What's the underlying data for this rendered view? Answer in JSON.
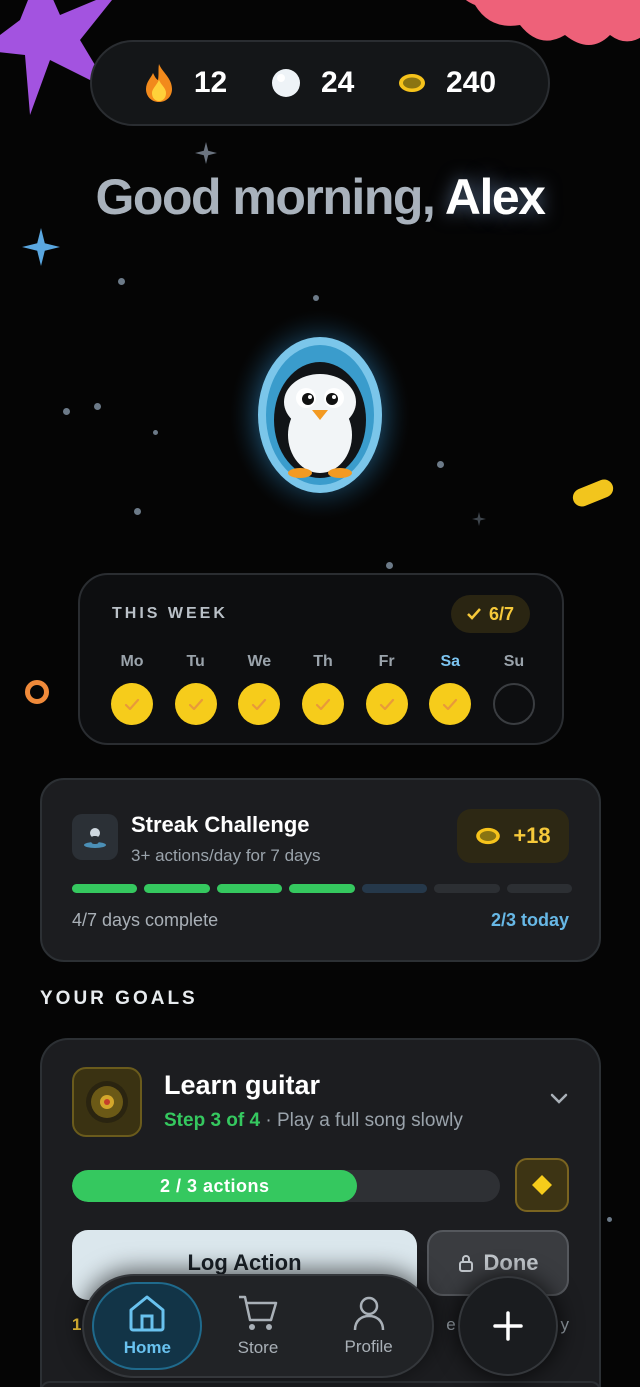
{
  "stats": {
    "streak": "12",
    "snowballs": "24",
    "coins": "240"
  },
  "greeting": {
    "prefix": "Good morning,",
    "name": "Alex"
  },
  "week": {
    "title": "THIS WEEK",
    "badge": "6/7",
    "days": [
      {
        "label": "Mo",
        "done": true
      },
      {
        "label": "Tu",
        "done": true
      },
      {
        "label": "We",
        "done": true
      },
      {
        "label": "Th",
        "done": true
      },
      {
        "label": "Fr",
        "done": true
      },
      {
        "label": "Sa",
        "done": true,
        "today": true
      },
      {
        "label": "Su",
        "done": false
      }
    ]
  },
  "streak_challenge": {
    "title": "Streak Challenge",
    "subtitle": "3+ actions/day for 7 days",
    "reward": "+18",
    "progress_left": "4/7 days complete",
    "progress_right": "2/3 today",
    "days_complete": 4,
    "days_total": 7
  },
  "goals_section": {
    "title": "YOUR GOALS"
  },
  "goal": {
    "title": "Learn guitar",
    "step": "Step 3 of 4",
    "step_desc": "· Play a full song slowly",
    "progress_label": "2 / 3 actions",
    "progress_fraction": 0.667,
    "log_button": "Log Action",
    "done_button": "Done",
    "peek_left": "1",
    "peek_right": "e",
    "peek_right2": "y"
  },
  "nav": {
    "home": "Home",
    "store": "Store",
    "profile": "Profile"
  },
  "colors": {
    "accent_green": "#35c85f",
    "accent_yellow": "#f6cc1b",
    "accent_blue": "#67b8e6"
  }
}
